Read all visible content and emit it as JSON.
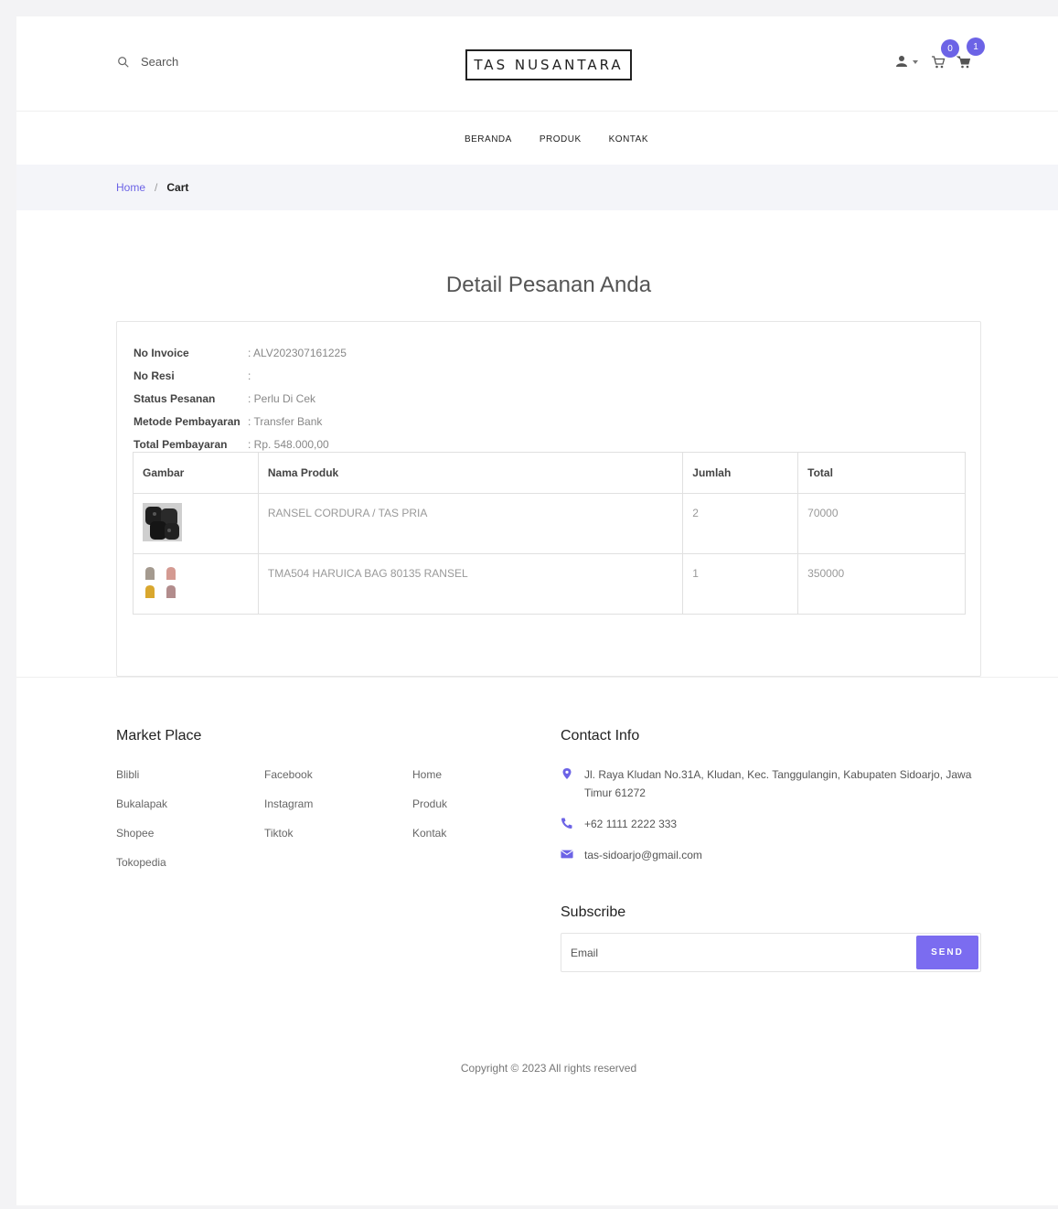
{
  "header": {
    "search_label": "Search",
    "logo": "TAS NUSANTARA",
    "cart_badge_1": "0",
    "cart_badge_2": "1"
  },
  "nav": {
    "items": [
      "BERANDA",
      "PRODUK",
      "KONTAK"
    ]
  },
  "breadcrumb": {
    "home": "Home",
    "separator": "/",
    "current": "Cart"
  },
  "page_title": "Detail Pesanan Anda",
  "order": {
    "fields": [
      {
        "label": "No Invoice",
        "value": ": ALV202307161225"
      },
      {
        "label": "No Resi",
        "value": ":"
      },
      {
        "label": "Status Pesanan",
        "value": ": Perlu Di Cek"
      },
      {
        "label": "Metode Pembayaran",
        "value": ": Transfer Bank"
      },
      {
        "label": "Total Pembayaran",
        "value": ": Rp. 548.000,00"
      }
    ],
    "columns": [
      "Gambar",
      "Nama Produk",
      "Jumlah",
      "Total"
    ],
    "rows": [
      {
        "name": "RANSEL CORDURA / TAS PRIA",
        "qty": "2",
        "total": "70000"
      },
      {
        "name": "TMA504 HARUICA BAG 80135 RANSEL",
        "qty": "1",
        "total": "350000"
      }
    ]
  },
  "footer": {
    "marketplace_title": "Market Place",
    "col_a": [
      "Blibli",
      "Bukalapak",
      "Shopee",
      "Tokopedia"
    ],
    "col_b": [
      "Facebook",
      "Instagram",
      "Tiktok"
    ],
    "col_c": [
      "Home",
      "Produk",
      "Kontak"
    ],
    "contact_title": "Contact Info",
    "address": "Jl. Raya Kludan No.31A, Kludan, Kec. Tanggulangin, Kabupaten Sidoarjo, Jawa Timur 61272",
    "phone": "+62 1111 2222 333",
    "email": "tas-sidoarjo@gmail.com",
    "subscribe_title": "Subscribe",
    "email_placeholder": "Email",
    "send_label": "SEND",
    "copyright": "Copyright © 2023 All rights reserved"
  },
  "colors": {
    "accent": "#6c63e6",
    "send_button": "#7b6cf0"
  }
}
